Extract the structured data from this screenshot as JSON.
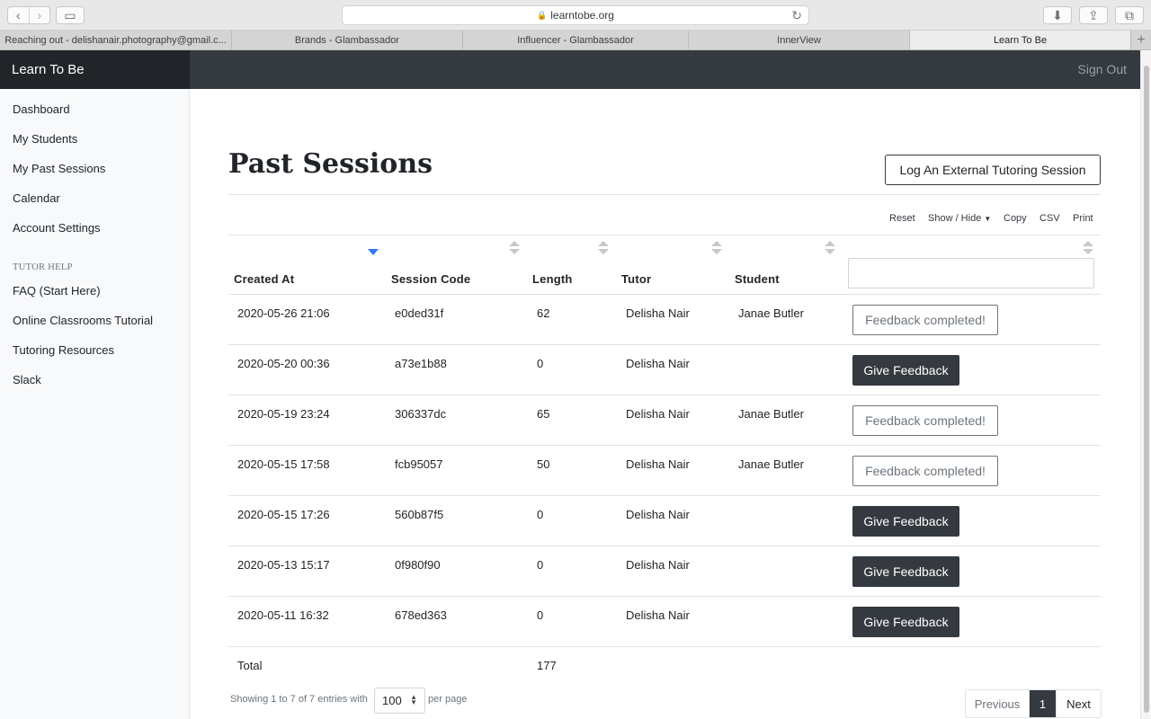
{
  "browser": {
    "url": "learntobe.org",
    "tabs": [
      {
        "label": "Reaching out - delishanair.photography@gmail.c..."
      },
      {
        "label": "Brands - Glambassador"
      },
      {
        "label": "Influencer - Glambassador"
      },
      {
        "label": "InnerView"
      },
      {
        "label": "Learn To Be"
      }
    ]
  },
  "app": {
    "brand": "Learn To Be",
    "sign_out": "Sign Out"
  },
  "sidebar": {
    "items": [
      {
        "label": "Dashboard"
      },
      {
        "label": "My Students"
      },
      {
        "label": "My Past Sessions"
      },
      {
        "label": "Calendar"
      },
      {
        "label": "Account Settings"
      }
    ],
    "help_heading": "TUTOR HELP",
    "help_items": [
      {
        "label": "FAQ (Start Here)"
      },
      {
        "label": "Online Classrooms Tutorial"
      },
      {
        "label": "Tutoring Resources"
      },
      {
        "label": "Slack"
      }
    ]
  },
  "main": {
    "title": "Past Sessions",
    "log_button": "Log An External Tutoring Session",
    "table_buttons": {
      "reset": "Reset",
      "show_hide": "Show / Hide",
      "copy": "Copy",
      "csv": "CSV",
      "print": "Print"
    },
    "columns": [
      "Created At",
      "Session Code",
      "Length",
      "Tutor",
      "Student"
    ],
    "search_value": "",
    "rows": [
      {
        "created": "2020-05-26 21:06",
        "code": "e0ded31f",
        "length": "62",
        "tutor": "Delisha Nair",
        "student": "Janae Butler",
        "action": "Feedback completed!"
      },
      {
        "created": "2020-05-20 00:36",
        "code": "a73e1b88",
        "length": "0",
        "tutor": "Delisha Nair",
        "student": "",
        "action": "Give Feedback"
      },
      {
        "created": "2020-05-19 23:24",
        "code": "306337dc",
        "length": "65",
        "tutor": "Delisha Nair",
        "student": "Janae Butler",
        "action": "Feedback completed!"
      },
      {
        "created": "2020-05-15 17:58",
        "code": "fcb95057",
        "length": "50",
        "tutor": "Delisha Nair",
        "student": "Janae Butler",
        "action": "Feedback completed!"
      },
      {
        "created": "2020-05-15 17:26",
        "code": "560b87f5",
        "length": "0",
        "tutor": "Delisha Nair",
        "student": "",
        "action": "Give Feedback"
      },
      {
        "created": "2020-05-13 15:17",
        "code": "0f980f90",
        "length": "0",
        "tutor": "Delisha Nair",
        "student": "",
        "action": "Give Feedback"
      },
      {
        "created": "2020-05-11 16:32",
        "code": "678ed363",
        "length": "0",
        "tutor": "Delisha Nair",
        "student": "",
        "action": "Give Feedback"
      }
    ],
    "total_label": "Total",
    "total_length": "177",
    "footer": {
      "showing": "Showing 1 to 7 of 7 entries with",
      "per_page_value": "100",
      "per_page_label": "per page",
      "prev": "Previous",
      "page": "1",
      "next": "Next"
    }
  },
  "colors": {
    "brand_bg": "#212529",
    "topbar_bg": "#343a40",
    "sidebar_bg": "#f8f9fa",
    "dark_button": "#343a40",
    "sort_active": "#3478f6"
  }
}
